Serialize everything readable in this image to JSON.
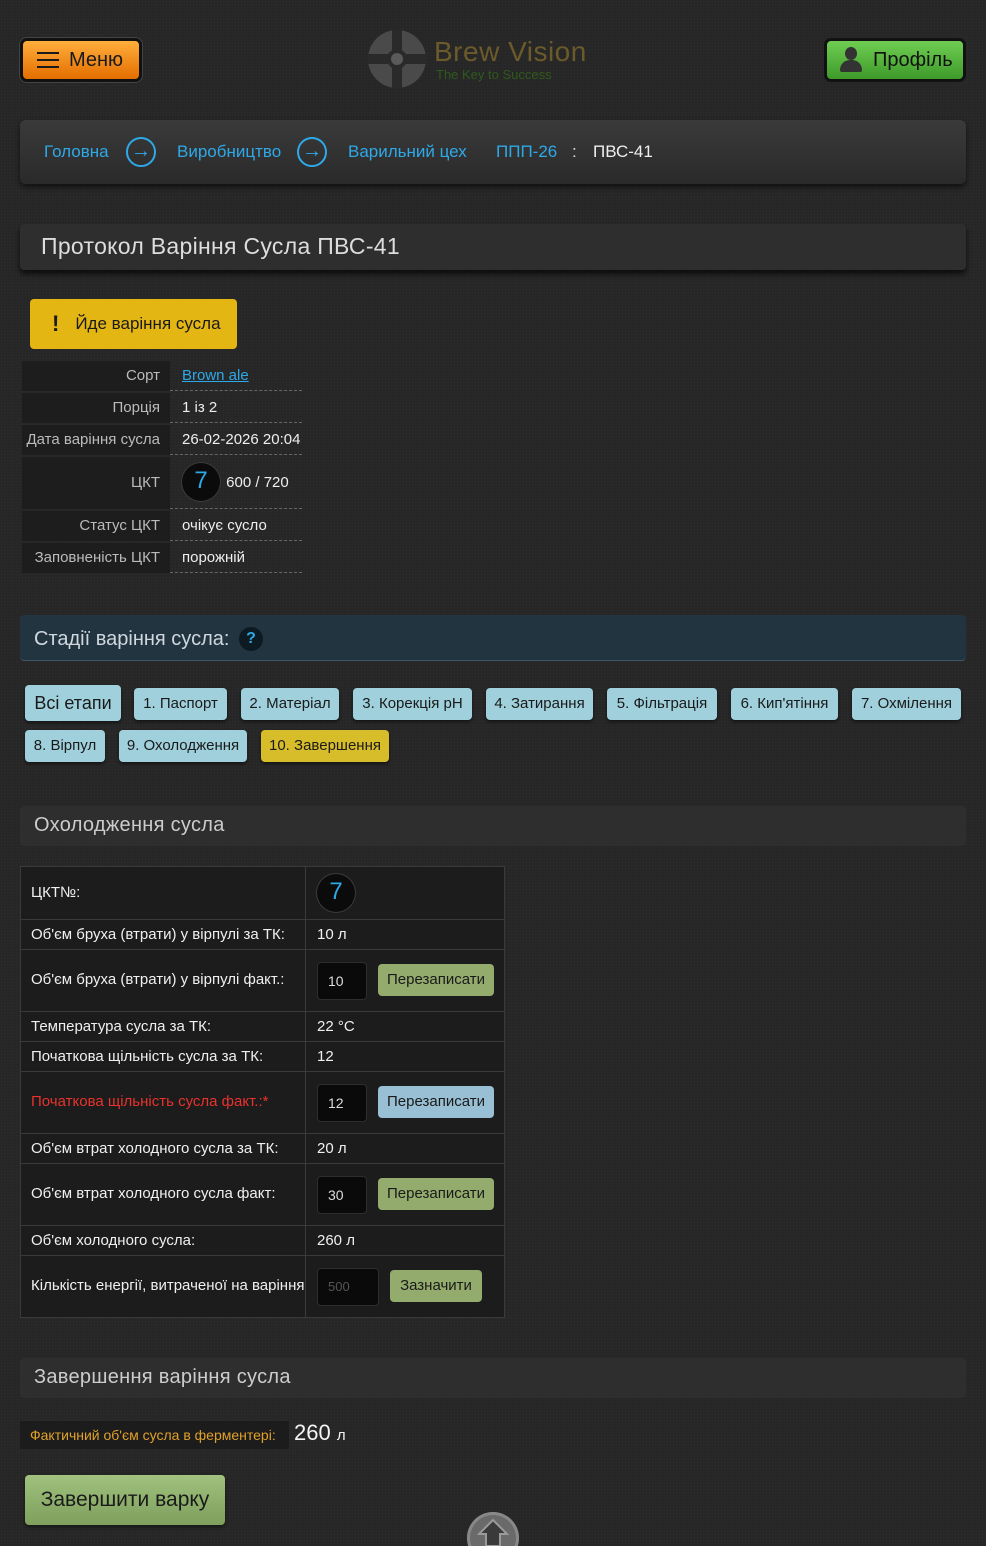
{
  "header": {
    "menu_label": "Меню",
    "logo_title": "Brew Vision",
    "logo_tagline": "The Key to Success",
    "profile_label": "Профіль"
  },
  "breadcrumb": {
    "items": [
      "Головна",
      "Виробництво",
      "Варильний цех",
      "ППП-26"
    ],
    "separator": ":",
    "current": "ПВС-41"
  },
  "page_title": "Протокол Варіння Сусла ПВС-41",
  "status_alert": "Йде варіння сусла",
  "info": {
    "sort_label": "Сорт",
    "sort_value": "Brown ale",
    "portion_label": "Порція",
    "portion_value": "1 із 2",
    "date_label": "Дата варіння сусла",
    "date_value": "26-02-2026 20:04",
    "tank_label": "ЦКТ",
    "tank_number": "7",
    "tank_volume": "600 / 720",
    "tank_status_label": "Статус ЦКТ",
    "tank_status_value": "очікує сусло",
    "tank_fill_label": "Заповненість ЦКТ",
    "tank_fill_value": "порожній"
  },
  "stages": {
    "title": "Стадії варіння сусла:",
    "help": "?",
    "buttons": [
      "Всі етапи",
      "1. Паспорт",
      "2. Матеріал",
      "3. Корекція pH",
      "4. Затирання",
      "5. Фільтрація",
      "6. Кип'ятіння",
      "7. Охмілення",
      "8. Вірпул",
      "9. Охолодження",
      "10. Завершення"
    ],
    "active": "10. Завершення"
  },
  "cooling": {
    "title": "Охолодження сусла",
    "rows": {
      "tank_label": "ЦКТ№:",
      "tank_value": "7",
      "trub_plan_label": "Об'єм бруха (втрати) у вірпулі за ТК:",
      "trub_plan_value": "10 л",
      "trub_fact_label": "Об'єм бруха (втрати) у вірпулі факт.:",
      "trub_fact_input": "10",
      "temp_label": "Температура сусла за ТК:",
      "temp_value": "22 °C",
      "gravity_plan_label": "Початкова щільність сусла за ТК:",
      "gravity_plan_value": "12",
      "gravity_fact_label": "Початкова щільність сусла факт.:*",
      "gravity_fact_input": "12",
      "cold_loss_plan_label": "Об'єм втрат холодного сусла за ТК:",
      "cold_loss_plan_value": "20 л",
      "cold_loss_fact_label": "Об'єм втрат холодного сусла факт:",
      "cold_loss_fact_input": "30",
      "cold_volume_label": "Об'єм холодного сусла:",
      "cold_volume_value": "260 л",
      "energy_label": "Кількість енергії, витраченої на варіння",
      "energy_placeholder": "500"
    },
    "rewrite_label": "Перезаписати",
    "mark_label": "Зазначити"
  },
  "completion": {
    "title": "Завершення варіння сусла",
    "fermenter_label": "Фактичний об'єм сусла в ферментері:",
    "fermenter_value": "260",
    "fermenter_unit": "л",
    "finish_label": "Завершити варку"
  },
  "colors": {
    "accent": "#2ea9e8",
    "menu_orange": "#f08a12",
    "profile_green": "#55b53c",
    "alert_yellow": "#e3b614",
    "stage_blue": "#9fd0dc",
    "stage_active": "#d8bd2a",
    "required_red": "#e8322d"
  },
  "icons": {
    "menu": "hamburger-icon",
    "profile": "user-silhouette-icon",
    "breadcrumb_sep": "arrow-right-circle-icon",
    "alert": "exclamation-icon",
    "help": "question-circle-icon",
    "scroll_top": "arrow-up-circle-icon"
  }
}
